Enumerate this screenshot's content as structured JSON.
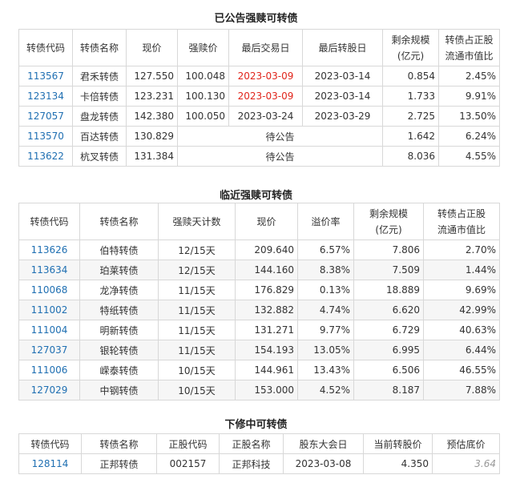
{
  "announced": {
    "title": "已公告强赎可转债",
    "headers": [
      "转债代码",
      "转债名称",
      "现价",
      "强赎价",
      "最后交易日",
      "最后转股日",
      "剩余规模\n(亿元)",
      "转债占正股\n流通市值比"
    ],
    "rows": [
      {
        "code": "113567",
        "name": "君禾转债",
        "price": "127.550",
        "redeem": "100.048",
        "last_trade": "2023-03-09",
        "last_convert": "2023-03-14",
        "remaining": "0.854",
        "ratio": "2.45%"
      },
      {
        "code": "123134",
        "name": "卡倍转债",
        "price": "123.231",
        "redeem": "100.130",
        "last_trade": "2023-03-09",
        "last_convert": "2023-03-14",
        "remaining": "1.733",
        "ratio": "9.91%"
      },
      {
        "code": "127057",
        "name": "盘龙转债",
        "price": "142.380",
        "redeem": "100.050",
        "last_trade": "2023-03-24",
        "last_convert": "2023-03-29",
        "remaining": "2.725",
        "ratio": "13.50%"
      },
      {
        "code": "113570",
        "name": "百达转债",
        "price": "130.829",
        "pending": "待公告",
        "remaining": "1.642",
        "ratio": "6.24%"
      },
      {
        "code": "113622",
        "name": "杭叉转债",
        "price": "131.384",
        "pending": "待公告",
        "remaining": "8.036",
        "ratio": "4.55%"
      }
    ],
    "highlight_color": "#e0251b"
  },
  "approaching": {
    "title": "临近强赎可转债",
    "headers": [
      "转债代码",
      "转债名称",
      "强赎天计数",
      "现价",
      "溢价率",
      "剩余规模\n(亿元)",
      "转债占正股\n流通市值比"
    ],
    "rows": [
      {
        "code": "113626",
        "name": "伯特转债",
        "days": "12/15天",
        "price": "209.640",
        "premium": "6.57%",
        "remaining": "7.806",
        "ratio": "2.70%"
      },
      {
        "code": "113634",
        "name": "珀莱转债",
        "days": "12/15天",
        "price": "144.160",
        "premium": "8.38%",
        "remaining": "7.509",
        "ratio": "1.44%"
      },
      {
        "code": "110068",
        "name": "龙净转债",
        "days": "11/15天",
        "price": "176.829",
        "premium": "0.13%",
        "remaining": "18.889",
        "ratio": "9.69%"
      },
      {
        "code": "111002",
        "name": "特纸转债",
        "days": "11/15天",
        "price": "132.882",
        "premium": "4.74%",
        "remaining": "6.620",
        "ratio": "42.99%"
      },
      {
        "code": "111004",
        "name": "明新转债",
        "days": "11/15天",
        "price": "131.271",
        "premium": "9.77%",
        "remaining": "6.729",
        "ratio": "40.63%"
      },
      {
        "code": "127037",
        "name": "银轮转债",
        "days": "11/15天",
        "price": "154.193",
        "premium": "13.05%",
        "remaining": "6.995",
        "ratio": "6.44%"
      },
      {
        "code": "111006",
        "name": "嵘泰转债",
        "days": "10/15天",
        "price": "144.961",
        "premium": "13.43%",
        "remaining": "6.506",
        "ratio": "46.55%"
      },
      {
        "code": "127029",
        "name": "中钢转债",
        "days": "10/15天",
        "price": "153.000",
        "premium": "4.52%",
        "remaining": "8.187",
        "ratio": "7.88%"
      }
    ]
  },
  "revision": {
    "title": "下修中可转债",
    "headers": [
      "转债代码",
      "转债名称",
      "正股代码",
      "正股名称",
      "股东大会日",
      "当前转股价",
      "预估底价"
    ],
    "rows": [
      {
        "code": "128114",
        "name": "正邦转债",
        "stock_code": "002157",
        "stock_name": "正邦科技",
        "meeting": "2023-03-08",
        "convert_price": "4.350",
        "floor": "3.64"
      }
    ]
  },
  "colors": {
    "link": "#1f6fb2",
    "border": "#d8d8d8",
    "stripe": "#f6f6f6"
  }
}
